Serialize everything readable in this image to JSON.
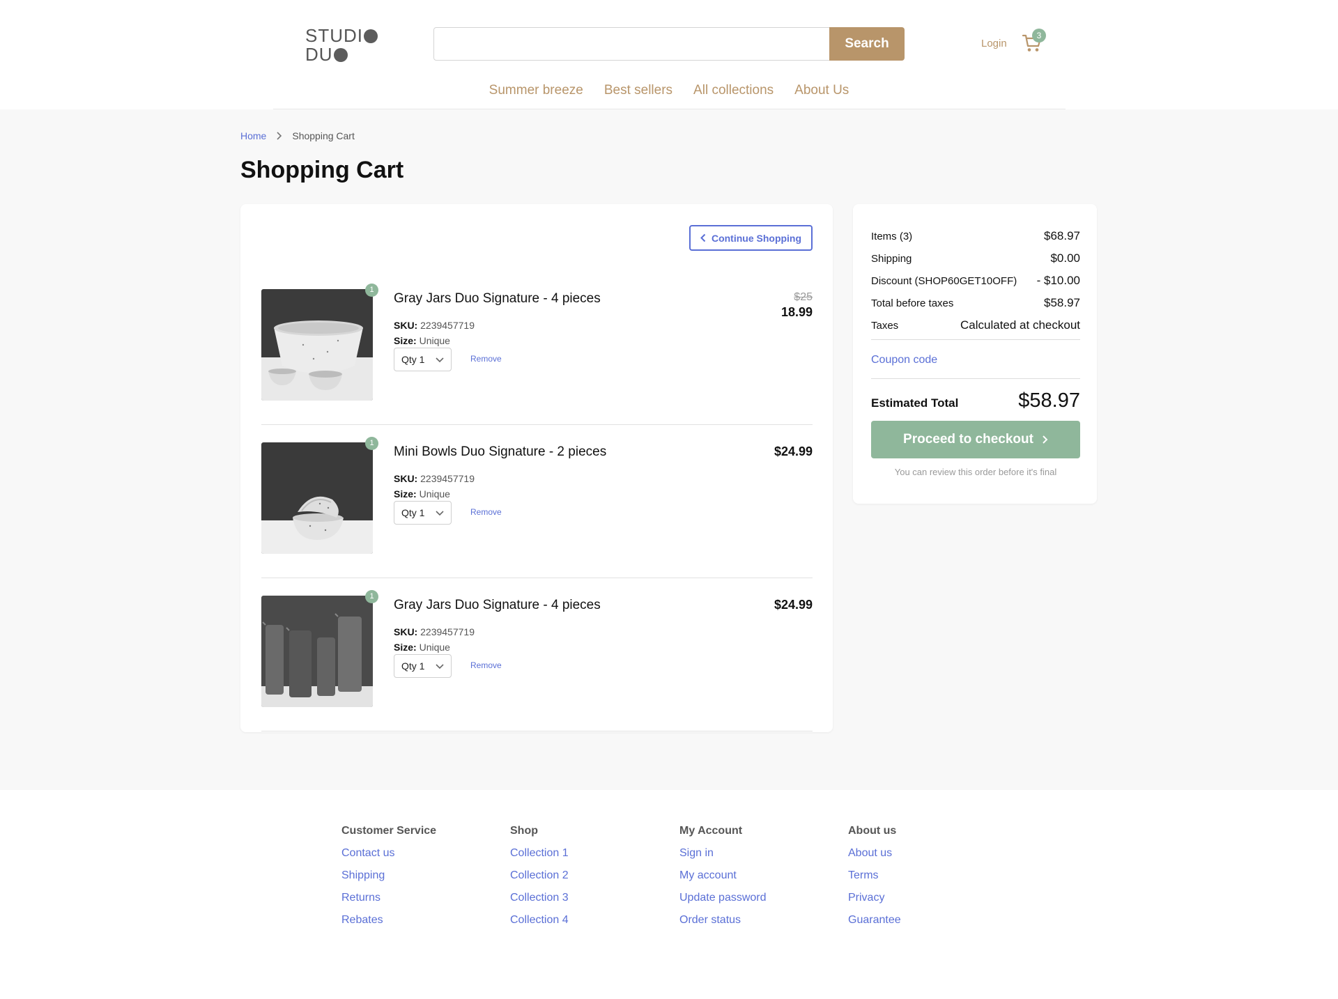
{
  "brand": {
    "line1": "STUDI",
    "line2": "DU"
  },
  "search": {
    "placeholder": "",
    "button_label": "Search"
  },
  "header": {
    "login_label": "Login",
    "cart_count": "3"
  },
  "nav": {
    "items": [
      {
        "label": "Summer breeze"
      },
      {
        "label": "Best sellers"
      },
      {
        "label": "All collections"
      },
      {
        "label": "About Us"
      }
    ]
  },
  "breadcrumb": {
    "home": "Home",
    "current": "Shopping Cart"
  },
  "page": {
    "title": "Shopping Cart"
  },
  "cart": {
    "continue_label": "Continue Shopping",
    "sku_key": "SKU:",
    "size_key": "Size:",
    "remove_label": "Remove",
    "items": [
      {
        "qty_badge": "1",
        "name": "Gray Jars Duo Signature - 4 pieces",
        "sku": "2239457719",
        "size": "Unique",
        "qty": "Qty 1",
        "old_price": "$25",
        "price": "18.99",
        "image": "white-speckled-bowls"
      },
      {
        "qty_badge": "1",
        "name": "Mini Bowls Duo Signature - 2 pieces",
        "sku": "2239457719",
        "size": "Unique",
        "qty": "Qty 1",
        "price": "$24.99",
        "image": "stacked-mini-bowls"
      },
      {
        "qty_badge": "1",
        "name": "Gray Jars Duo Signature - 4 pieces",
        "sku": "2239457719",
        "size": "Unique",
        "qty": "Qty 1",
        "price": "$24.99",
        "image": "gray-jars"
      }
    ]
  },
  "summary": {
    "items_label": "Items (3)",
    "items_value": "$68.97",
    "shipping_label": "Shipping",
    "shipping_value": "$0.00",
    "discount_label": "Discount (SHOP60GET10OFF)",
    "discount_value": "- $10.00",
    "before_tax_label": "Total before taxes",
    "before_tax_value": "$58.97",
    "taxes_label": "Taxes",
    "taxes_value": "Calculated at checkout",
    "coupon_label": "Coupon code",
    "estimated_label": "Estimated Total",
    "estimated_value": "$58.97",
    "checkout_label": "Proceed to checkout",
    "review_note": "You can review this order before it's final"
  },
  "footer": {
    "columns": [
      {
        "heading": "Customer Service",
        "links": [
          "Contact us",
          "Shipping",
          "Returns",
          "Rebates"
        ]
      },
      {
        "heading": "Shop",
        "links": [
          "Collection 1",
          "Collection 2",
          "Collection 3",
          "Collection 4"
        ]
      },
      {
        "heading": "My Account",
        "links": [
          "Sign in",
          "My account",
          "Update password",
          "Order status"
        ]
      },
      {
        "heading": "About us",
        "links": [
          "About us",
          "Terms",
          "Privacy",
          "Guarantee"
        ]
      }
    ]
  },
  "colors": {
    "accent_gold": "#b8956a",
    "link_blue": "#5a6fd6",
    "badge_green": "#8fb79b"
  }
}
